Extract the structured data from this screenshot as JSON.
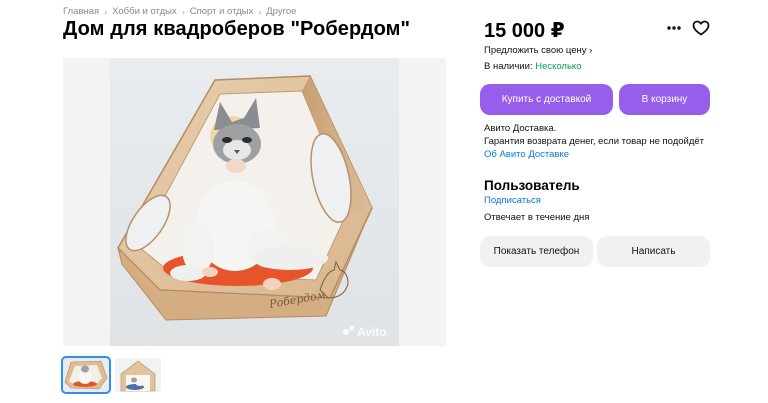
{
  "breadcrumbs": [
    "Главная",
    "Хобби и отдых",
    "Спорт и отдых",
    "Другое"
  ],
  "breadcrumb_separator": "›",
  "title": "Дом для квадроберов \"Робердом\"",
  "price": "15 000 ₽",
  "offer_price_link": "Предложить свою цену ›",
  "availability": {
    "label": "В наличии:",
    "value": "Несколько",
    "value_color": "#02a44a"
  },
  "buttons": {
    "buy_with_delivery": "Купить с доставкой",
    "add_to_cart": "В корзину",
    "show_phone": "Показать телефон",
    "write_message": "Написать"
  },
  "delivery": {
    "line1": "Авито Доставка.",
    "line2": "Гарантия возврата денег, если товар не подойдёт",
    "link": "Об Авито Доставке"
  },
  "seller": {
    "name": "Пользователь",
    "subscribe": "Подписаться",
    "response_time": "Отвечает в течение дня"
  },
  "photo": {
    "brand_text": "Робердом",
    "watermark": "Avito"
  },
  "icons": {
    "more": "more-dots-icon",
    "favorite": "heart-icon"
  },
  "colors": {
    "accent": "#965eeb",
    "link": "#0a79d6",
    "secondary_button": "#f2f1f0"
  }
}
